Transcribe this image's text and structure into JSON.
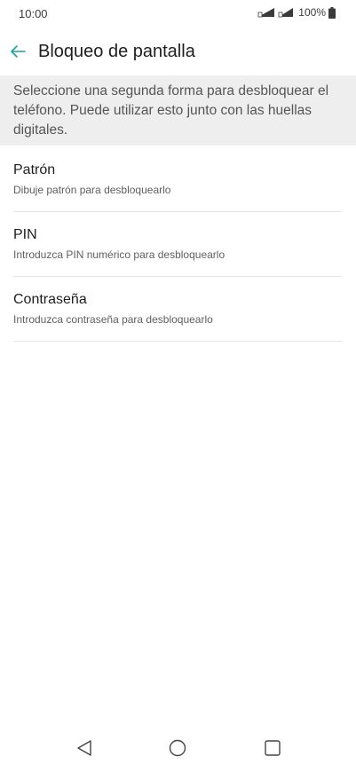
{
  "status_bar": {
    "time": "10:00",
    "battery_percent": "100%",
    "icons": [
      "signal-icon",
      "signal-icon",
      "battery-icon"
    ]
  },
  "app_bar": {
    "title": "Bloqueo de pantalla",
    "back_icon": "arrow-left-icon",
    "accent_color": "#1aa39a"
  },
  "info_banner": {
    "text": "Seleccione una segunda forma para desbloquear el teléfono. Puede utilizar esto junto con las huellas digitales."
  },
  "options": [
    {
      "title": "Patrón",
      "subtitle": "Dibuje patrón para desbloquearlo"
    },
    {
      "title": "PIN",
      "subtitle": "Introduzca PIN numérico para desbloquearlo"
    },
    {
      "title": "Contraseña",
      "subtitle": "Introduzca contraseña para desbloquearlo"
    }
  ],
  "nav_bar": {
    "icons": [
      "back-triangle-icon",
      "home-circle-icon",
      "recent-square-icon"
    ]
  }
}
